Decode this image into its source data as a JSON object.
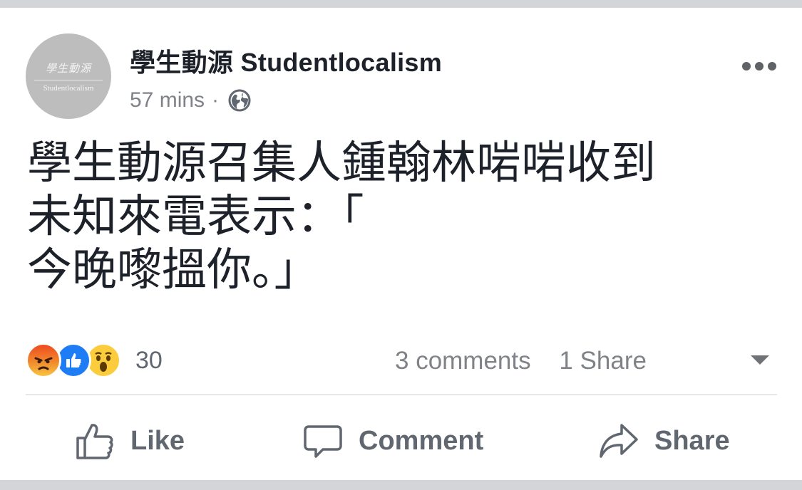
{
  "post": {
    "page_name": "學生動源 Studentlocalism",
    "time": "57 mins",
    "separator": "·",
    "privacy_icon": "globe-icon",
    "avatar": {
      "cn": "學生動源",
      "en": "Studentlocalism"
    },
    "text": "學生動源召集人鍾翰林啱啱收到\n未知來電表示：「\n今晚嚟搵你。」"
  },
  "engagement": {
    "reaction_icons": [
      "angry-icon",
      "like-icon",
      "wow-icon"
    ],
    "reaction_count": "30",
    "comments": "3 comments",
    "shares": "1 Share"
  },
  "actions": {
    "like_label": "Like",
    "comment_label": "Comment",
    "share_label": "Share"
  },
  "colors": {
    "text": "#1d2129",
    "secondary": "#7f8287",
    "like_blue": "#1e7cf4",
    "angry": "#f04a1f",
    "wow": "#fbcc3c"
  }
}
